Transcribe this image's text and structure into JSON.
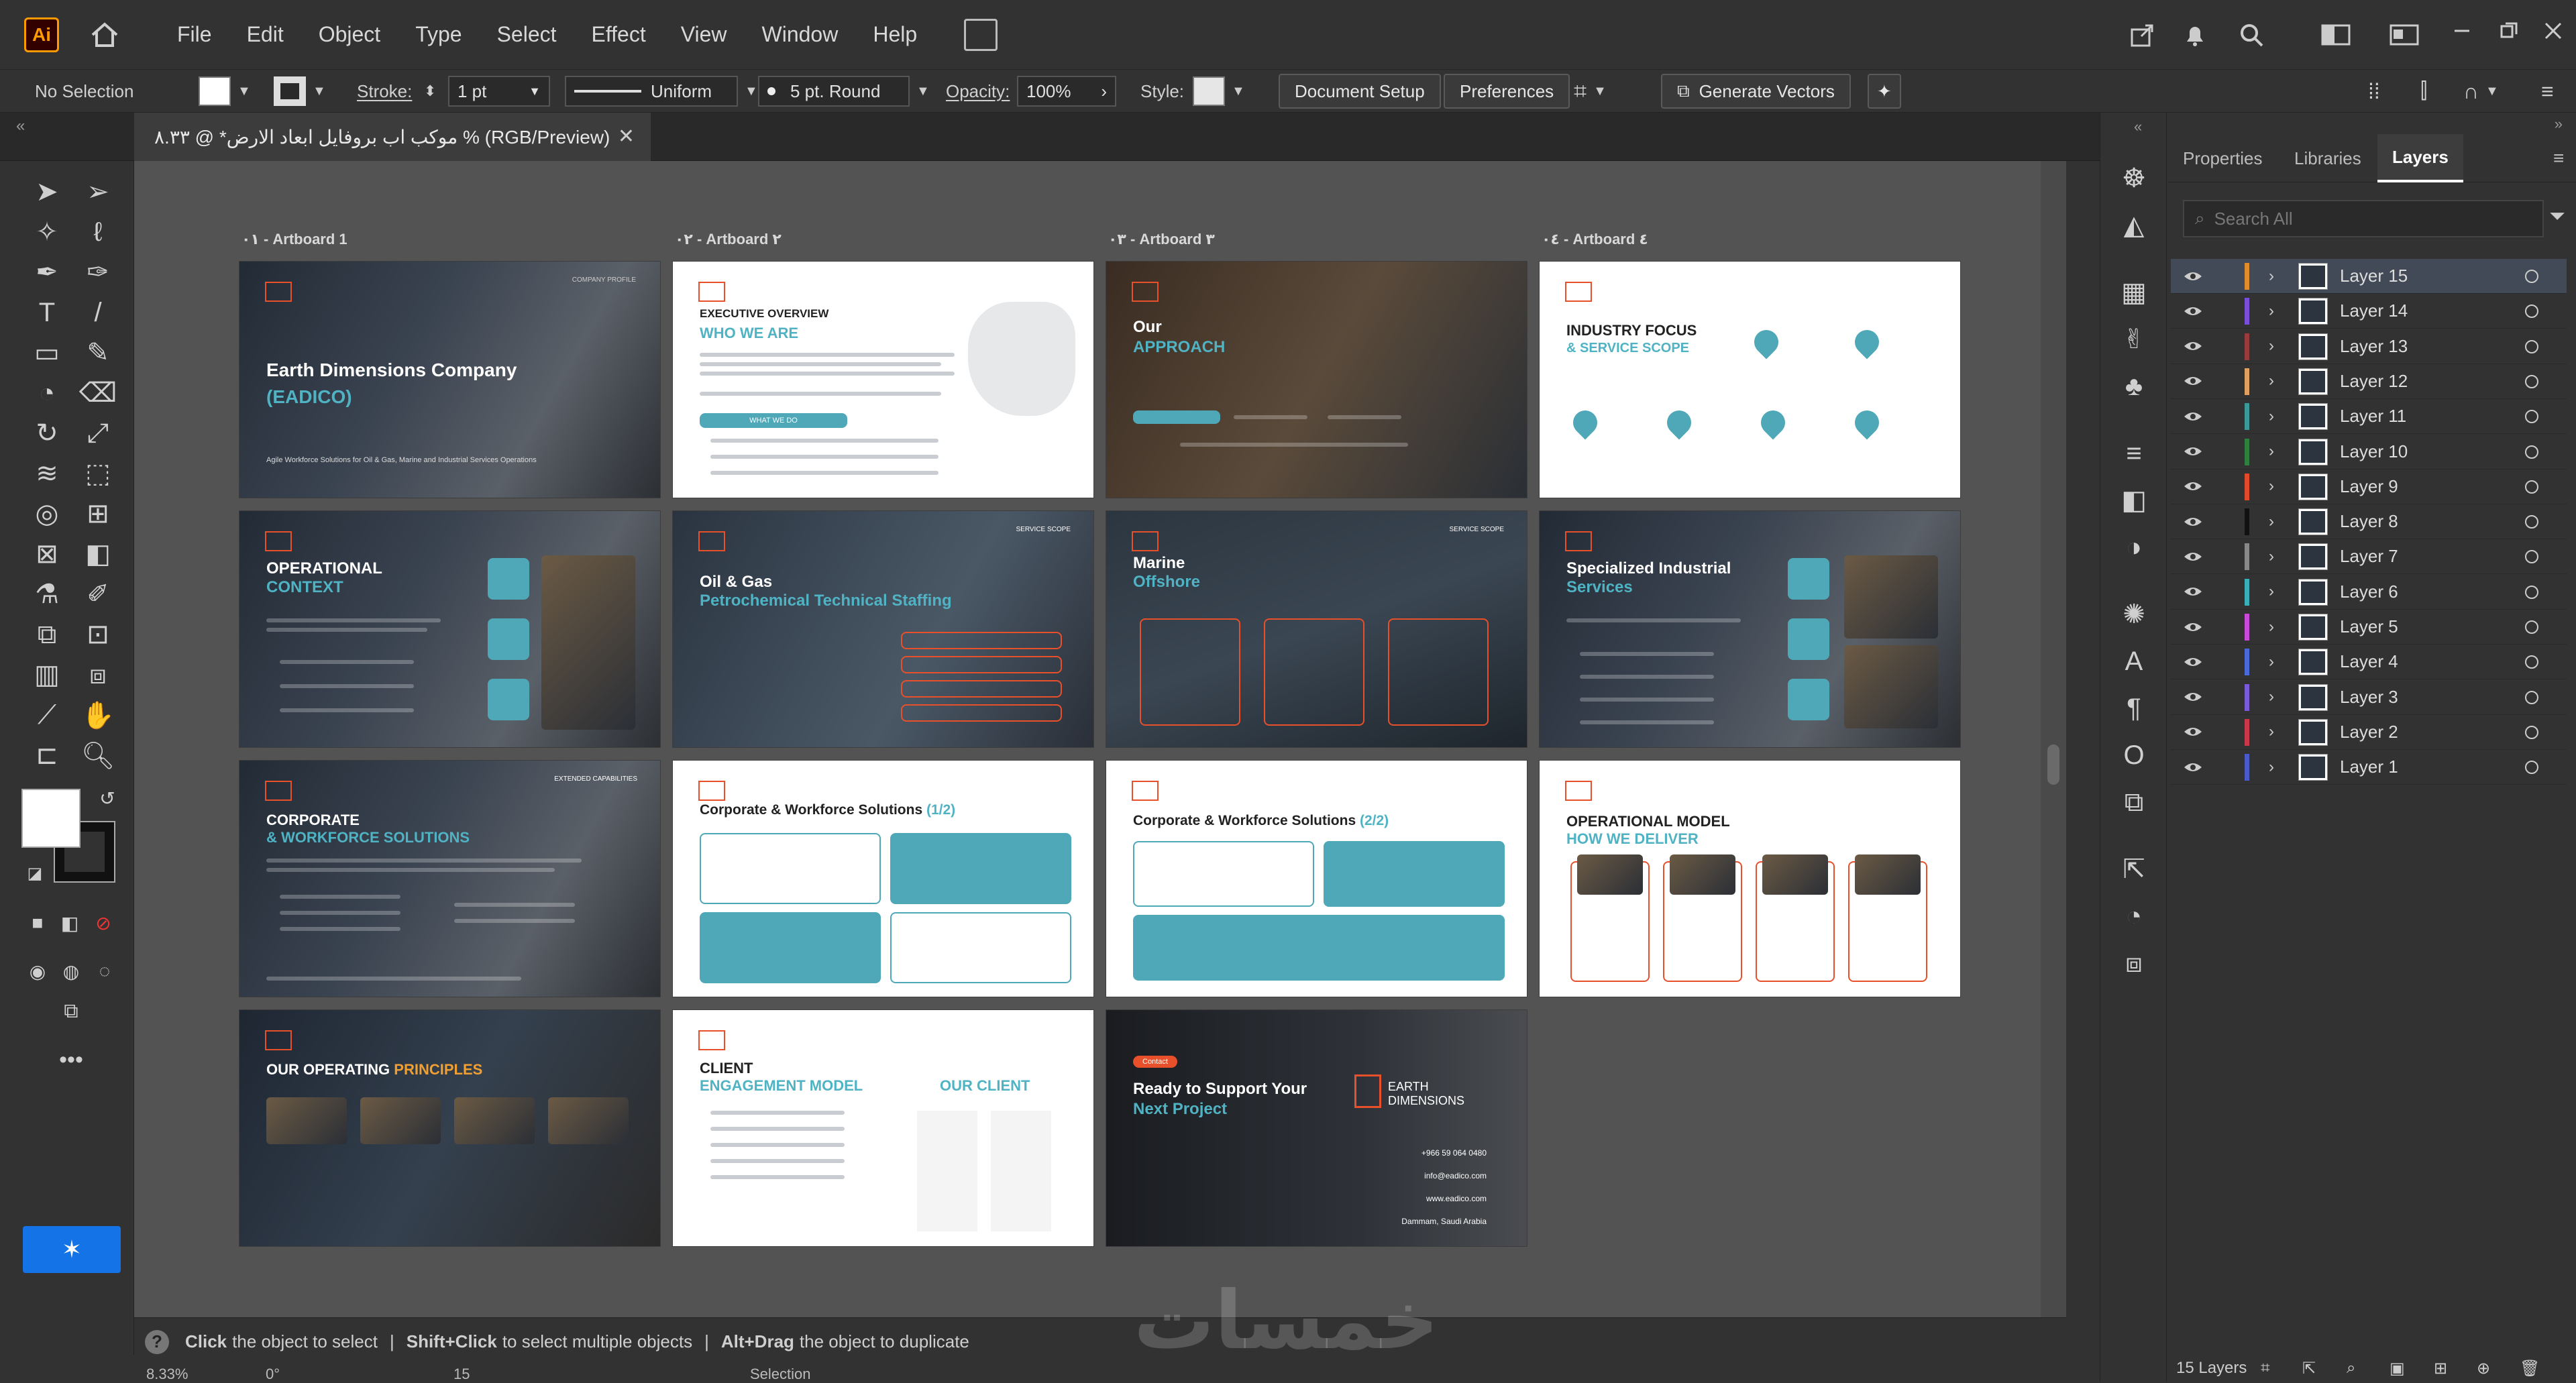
{
  "app": {
    "logo": "Ai"
  },
  "menu": [
    "File",
    "Edit",
    "Object",
    "Type",
    "Select",
    "Effect",
    "View",
    "Window",
    "Help"
  ],
  "control_bar": {
    "selection": "No Selection",
    "stroke_label": "Stroke:",
    "stroke_value": "1 pt",
    "stroke_profile": "Uniform",
    "brush": "5 pt. Round",
    "opacity_label": "Opacity:",
    "opacity_value": "100%",
    "style_label": "Style:",
    "document_setup": "Document Setup",
    "preferences": "Preferences",
    "generate_vectors": "Generate Vectors"
  },
  "document_tab": {
    "title": "موكب اب بروفايل ابعاد الارض* @ ٨.٣٣ % (RGB/Preview)"
  },
  "artboards": {
    "labels": [
      "٠١ - Artboard 1",
      "٠٢ - Artboard ٢",
      "٠٣ - Artboard ٣",
      "٠٤ - Artboard ٤"
    ],
    "a1": {
      "title": "Earth Dimensions Company",
      "subtitle": "(EADICO)",
      "tag": "COMPANY PROFILE",
      "tagline": "Agile Workforce Solutions for Oil & Gas, Marine and Industrial Services Operations"
    },
    "a2": {
      "kicker": "EXECUTIVE OVERVIEW",
      "title": "WHO WE ARE",
      "pill": "WHAT WE DO"
    },
    "a3": {
      "title": "Our",
      "title2": "APPROACH"
    },
    "a4": {
      "title": "INDUSTRY FOCUS",
      "title2": "& SERVICE SCOPE"
    },
    "b1": {
      "title": "OPERATIONAL",
      "title2": "CONTEXT"
    },
    "b2": {
      "title": "Oil & Gas",
      "title2": "Petrochemical Technical Staffing",
      "tag": "SERVICE SCOPE"
    },
    "b3": {
      "title": "Marine",
      "title2": "Offshore",
      "tag": "SERVICE SCOPE"
    },
    "b4": {
      "title": "Specialized Industrial",
      "title2": "Services"
    },
    "c1": {
      "title": "CORPORATE",
      "title2": "& WORKFORCE SOLUTIONS",
      "tag": "EXTENDED CAPABILITIES"
    },
    "c2": {
      "title": "Corporate & Workforce Solutions",
      "title2": "(1/2)"
    },
    "c3": {
      "title": "Corporate & Workforce Solutions",
      "title2": "(2/2)"
    },
    "c4": {
      "title": "OPERATIONAL MODEL",
      "title2": "HOW WE DELIVER"
    },
    "d1": {
      "title": "OUR OPERATING",
      "title2": "PRINCIPLES"
    },
    "d2": {
      "title": "CLIENT",
      "title2": "ENGAGEMENT MODEL",
      "title3": "OUR CLIENT"
    },
    "d3": {
      "tag": "Contact",
      "title": "Ready to Support Your",
      "title2": "Next Project",
      "brand": "EARTH DIMENSIONS",
      "phone": "+966 59 064 0480",
      "email": "info@eadico.com",
      "web": "www.eadico.com",
      "city": "Dammam, Saudi Arabia"
    }
  },
  "status": {
    "help1_bold": "Click",
    "help1": "the object to select",
    "help2_bold": "Shift+Click",
    "help2": "to select multiple objects",
    "help3_bold": "Alt+Drag",
    "help3": "the object to duplicate"
  },
  "bottom": {
    "zoom": "8.33%",
    "rotation": "0°",
    "artboard_num": "15",
    "mode": "Selection"
  },
  "panel": {
    "tabs": [
      "Properties",
      "Libraries",
      "Layers"
    ],
    "search_placeholder": "Search All",
    "layers": [
      "Layer 15",
      "Layer 14",
      "Layer 13",
      "Layer 12",
      "Layer 11",
      "Layer 10",
      "Layer 9",
      "Layer 8",
      "Layer 7",
      "Layer 6",
      "Layer 5",
      "Layer 4",
      "Layer 3",
      "Layer 2",
      "Layer 1"
    ],
    "layer_colors": [
      "#e08c2b",
      "#7a4ed9",
      "#9a3a3a",
      "#e0a060",
      "#3a9a9a",
      "#2f7f3f",
      "#e04a2b",
      "#111111",
      "#888888",
      "#39b0b8",
      "#c94ad9",
      "#4a6ad9",
      "#7a5ad9",
      "#c9384a",
      "#4a5ac9"
    ],
    "footer": "15 Layers"
  },
  "watermark": "خمسات"
}
